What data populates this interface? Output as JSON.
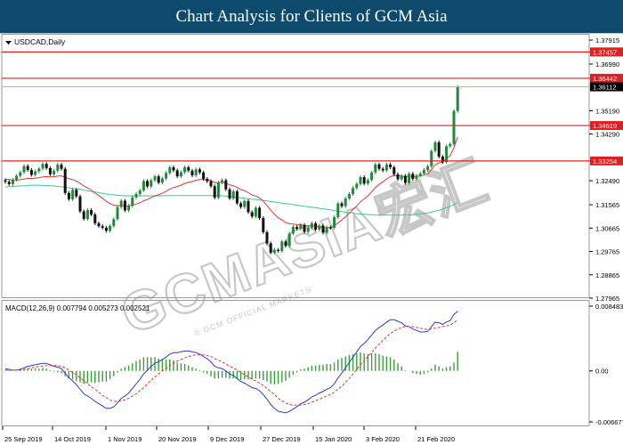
{
  "banner": {
    "title": "Chart Analysis for Clients of GCM Asia"
  },
  "instrument": {
    "label": "USDCAD,Daily"
  },
  "watermark": {
    "text": "GCMASIA宏汇",
    "subtext": "© GCM OFFICIAL MARKETS"
  },
  "colors": {
    "banner": "#0e4a6b",
    "bull": "#1f8a3a",
    "bear": "#111111",
    "ma_fast": "#e8332e",
    "ma_slow": "#3ec98d",
    "level_line": "#e02020",
    "level_tag": "#e02020",
    "price_tag": "#000000",
    "macd_line": "#2b3bd1",
    "macd_signal": "#e8332e",
    "macd_hist": "#3a9e3a"
  },
  "price_axis": {
    "ticks": [
      "1.37915",
      "1.36990",
      "1.35190",
      "1.34290",
      "1.32490",
      "1.31565",
      "1.30665",
      "1.29765",
      "1.28865",
      "1.27965"
    ]
  },
  "macd_axis": {
    "ticks": [
      "0.008483",
      "0.00",
      "-0.006677"
    ]
  },
  "macd": {
    "label": "MACD(12,26,9) 0.007794 0.005273 0.002521"
  },
  "time_axis": {
    "labels": [
      "25 Sep 2019",
      "14 Oct 2019",
      "1 Nov 2019",
      "20 Nov 2019",
      "9 Dec 2019",
      "27 Dec 2019",
      "15 Jan 2020",
      "3 Feb 2020",
      "21 Feb 2020"
    ]
  },
  "chart_data": {
    "type": "candlestick",
    "symbol": "USDCAD",
    "timeframe": "Daily",
    "ylim": [
      1.27965,
      1.37915
    ],
    "levels": [
      {
        "value": 1.37457,
        "label": "1.37457"
      },
      {
        "value": 1.36442,
        "label": "1.36442"
      },
      {
        "value": 1.34619,
        "label": "1.34619"
      },
      {
        "value": 1.33254,
        "label": "1.33254"
      }
    ],
    "current_price": {
      "value": 1.36112,
      "label": "1.36112"
    },
    "close": [
      1.3245,
      1.3236,
      1.3253,
      1.3268,
      1.3282,
      1.3306,
      1.3291,
      1.3272,
      1.3285,
      1.3296,
      1.3314,
      1.3298,
      1.3274,
      1.3288,
      1.3311,
      1.3295,
      1.3202,
      1.3178,
      1.3214,
      1.3189,
      1.3131,
      1.3102,
      1.3136,
      1.3119,
      1.3085,
      1.3074,
      1.3068,
      1.3056,
      1.3075,
      1.3101,
      1.3148,
      1.3172,
      1.3135,
      1.3153,
      1.3185,
      1.3198,
      1.3212,
      1.3248,
      1.3227,
      1.3251,
      1.3266,
      1.3242,
      1.3258,
      1.3279,
      1.3301,
      1.3289,
      1.3266,
      1.3282,
      1.3301,
      1.3288,
      1.327,
      1.3293,
      1.3281,
      1.3256,
      1.3247,
      1.3228,
      1.3184,
      1.3242,
      1.3251,
      1.3216,
      1.3181,
      1.3208,
      1.3162,
      1.3148,
      1.3171,
      1.3128,
      1.3111,
      1.3145,
      1.3105,
      1.3051,
      1.3008,
      1.2972,
      1.2983,
      1.2978,
      1.3015,
      1.2998,
      1.3046,
      1.3071,
      1.3064,
      1.3079,
      1.3052,
      1.3068,
      1.3085,
      1.3061,
      1.3076,
      1.3049,
      1.3069,
      1.3068,
      1.3109,
      1.3162,
      1.3151,
      1.3181,
      1.3198,
      1.3221,
      1.3237,
      1.3263,
      1.3238,
      1.3252,
      1.3281,
      1.3312,
      1.3295,
      1.3289,
      1.3312,
      1.3301,
      1.3274,
      1.3255,
      1.3268,
      1.3241,
      1.3276,
      1.3256,
      1.3269,
      1.3277,
      1.3291,
      1.3305,
      1.3364,
      1.3397,
      1.3342,
      1.3321,
      1.3382,
      1.3391,
      1.3518,
      1.3611
    ],
    "ma_fast": [
      1.3256,
      1.3254,
      1.3252,
      1.3252,
      1.3253,
      1.3256,
      1.3258,
      1.3258,
      1.3259,
      1.3261,
      1.3264,
      1.3265,
      1.3264,
      1.3265,
      1.3267,
      1.3268,
      1.3263,
      1.3257,
      1.3254,
      1.3248,
      1.3239,
      1.3229,
      1.3222,
      1.3213,
      1.3202,
      1.3192,
      1.3181,
      1.317,
      1.3161,
      1.3155,
      1.3153,
      1.3154,
      1.3152,
      1.3152,
      1.3155,
      1.3159,
      1.3164,
      1.3172,
      1.3177,
      1.3184,
      1.3191,
      1.3195,
      1.3201,
      1.3208,
      1.3217,
      1.3223,
      1.3227,
      1.3232,
      1.3239,
      1.3243,
      1.3246,
      1.3251,
      1.3254,
      1.3254,
      1.3253,
      1.325,
      1.3242,
      1.3242,
      1.3243,
      1.324,
      1.3233,
      1.323,
      1.3223,
      1.3215,
      1.3211,
      1.3203,
      1.3194,
      1.319,
      1.3183,
      1.317,
      1.3154,
      1.3135,
      1.312,
      1.3106,
      1.3098,
      1.3088,
      1.3083,
      1.3082,
      1.308,
      1.308,
      1.3076,
      1.3075,
      1.3076,
      1.3073,
      1.3073,
      1.3069,
      1.3069,
      1.3069,
      1.3074,
      1.3087,
      1.3097,
      1.311,
      1.3123,
      1.3138,
      1.3152,
      1.3168,
      1.3179,
      1.3191,
      1.3206,
      1.3223,
      1.3235,
      1.3245,
      1.3256,
      1.3265,
      1.3269,
      1.3268,
      1.3268,
      1.3265,
      1.3267,
      1.3266,
      1.3266,
      1.3268,
      1.3271,
      1.3276,
      1.3292,
      1.3311,
      1.3318,
      1.332,
      1.3334,
      1.3346,
      1.3377,
      1.3418
    ],
    "ma_slow": [
      1.3225,
      1.3226,
      1.3227,
      1.3228,
      1.3229,
      1.323,
      1.3231,
      1.3232,
      1.3232,
      1.3232,
      1.3231,
      1.3231,
      1.323,
      1.3229,
      1.3227,
      1.3226,
      1.3224,
      1.3222,
      1.322,
      1.3218,
      1.3216,
      1.3213,
      1.3211,
      1.3208,
      1.3206,
      1.3203,
      1.3201,
      1.3198,
      1.3196,
      1.3195,
      1.3193,
      1.3192,
      1.3191,
      1.3191,
      1.3191,
      1.3191,
      1.3191,
      1.3191,
      1.3191,
      1.3191,
      1.3191,
      1.3191,
      1.3191,
      1.3192,
      1.3192,
      1.3192,
      1.3192,
      1.3192,
      1.3192,
      1.3192,
      1.3192,
      1.3192,
      1.3192,
      1.3192,
      1.3192,
      1.3192,
      1.3192,
      1.3192,
      1.3191,
      1.319,
      1.3189,
      1.3187,
      1.3185,
      1.3183,
      1.3182,
      1.318,
      1.3178,
      1.3177,
      1.3175,
      1.3173,
      1.3171,
      1.3169,
      1.3167,
      1.3165,
      1.3163,
      1.3161,
      1.3159,
      1.3157,
      1.3155,
      1.3153,
      1.3151,
      1.3149,
      1.3147,
      1.3145,
      1.3143,
      1.3141,
      1.3139,
      1.3137,
      1.3134,
      1.3132,
      1.313,
      1.3128,
      1.3126,
      1.3124,
      1.3122,
      1.3121,
      1.312,
      1.3119,
      1.3118,
      1.3118,
      1.3117,
      1.3117,
      1.3117,
      1.3117,
      1.3117,
      1.3117,
      1.3117,
      1.3117,
      1.3117,
      1.3118,
      1.3119,
      1.3121,
      1.3123,
      1.3125,
      1.3128,
      1.3132,
      1.3136,
      1.314,
      1.3145,
      1.3151,
      1.3157,
      1.3165
    ],
    "macd_series": {
      "macd": [
        0.0003,
        0.0002,
        0.0001,
        0.0001,
        0.0002,
        0.0004,
        0.0006,
        0.0007,
        0.0008,
        0.0009,
        0.001,
        0.001,
        0.0008,
        0.0006,
        0.0005,
        0.0003,
        -0.0003,
        -0.0009,
        -0.0013,
        -0.0018,
        -0.0024,
        -0.003,
        -0.0033,
        -0.0036,
        -0.004,
        -0.0043,
        -0.0046,
        -0.0049,
        -0.0049,
        -0.0047,
        -0.0042,
        -0.0036,
        -0.0033,
        -0.0029,
        -0.0023,
        -0.0017,
        -0.0011,
        -0.0004,
        0.0001,
        0.0006,
        0.001,
        0.0012,
        0.0015,
        0.0018,
        0.0022,
        0.0024,
        0.0024,
        0.0025,
        0.0026,
        0.0026,
        0.0025,
        0.0024,
        0.0022,
        0.0019,
        0.0016,
        0.0012,
        0.0006,
        0.0004,
        0.0003,
        0.0,
        -0.0004,
        -0.0006,
        -0.001,
        -0.0014,
        -0.0016,
        -0.0019,
        -0.0022,
        -0.0023,
        -0.0026,
        -0.0031,
        -0.0037,
        -0.0044,
        -0.0049,
        -0.0053,
        -0.0054,
        -0.0055,
        -0.0053,
        -0.005,
        -0.0047,
        -0.0043,
        -0.0041,
        -0.0038,
        -0.0034,
        -0.0032,
        -0.0029,
        -0.0027,
        -0.0024,
        -0.0022,
        -0.0017,
        -0.0009,
        -0.0003,
        0.0004,
        0.0011,
        0.0018,
        0.0025,
        0.0032,
        0.0036,
        0.0041,
        0.0047,
        0.0053,
        0.0057,
        0.006,
        0.0064,
        0.0067,
        0.0067,
        0.0065,
        0.0063,
        0.0059,
        0.0058,
        0.0055,
        0.0053,
        0.0051,
        0.0051,
        0.0052,
        0.0058,
        0.0064,
        0.0063,
        0.0061,
        0.0064,
        0.0066,
        0.0074,
        0.0078
      ],
      "signal": [
        0.0001,
        0.0001,
        0.0001,
        0.0001,
        0.0001,
        0.0002,
        0.0003,
        0.0004,
        0.0005,
        0.0006,
        0.0006,
        0.0007,
        0.0007,
        0.0007,
        0.0007,
        0.0006,
        0.0004,
        0.0001,
        -0.0002,
        -0.0005,
        -0.0009,
        -0.0013,
        -0.0017,
        -0.0021,
        -0.0024,
        -0.0028,
        -0.0032,
        -0.0035,
        -0.0038,
        -0.004,
        -0.004,
        -0.0039,
        -0.0038,
        -0.0036,
        -0.0033,
        -0.003,
        -0.0026,
        -0.0022,
        -0.0017,
        -0.0012,
        -0.0008,
        -0.0004,
        -0.0,
        0.0003,
        0.0007,
        0.001,
        0.0013,
        0.0015,
        0.0017,
        0.0019,
        0.002,
        0.0021,
        0.0021,
        0.0021,
        0.002,
        0.0019,
        0.0016,
        0.0014,
        0.0012,
        0.0009,
        0.0006,
        0.0004,
        0.0001,
        -0.0002,
        -0.0005,
        -0.0008,
        -0.0011,
        -0.0013,
        -0.0016,
        -0.0019,
        -0.0023,
        -0.0027,
        -0.0031,
        -0.0036,
        -0.0039,
        -0.0042,
        -0.0044,
        -0.0045,
        -0.0045,
        -0.0045,
        -0.0044,
        -0.0043,
        -0.0041,
        -0.0039,
        -0.0037,
        -0.0035,
        -0.0033,
        -0.0031,
        -0.0028,
        -0.0024,
        -0.002,
        -0.0015,
        -0.001,
        -0.0004,
        0.0002,
        0.0008,
        0.0013,
        0.0019,
        0.0024,
        0.003,
        0.0035,
        0.004,
        0.0045,
        0.0049,
        0.0052,
        0.0055,
        0.0057,
        0.0058,
        0.0058,
        0.0058,
        0.0057,
        0.0056,
        0.0055,
        0.0054,
        0.0055,
        0.0056,
        0.0057,
        0.0058,
        0.0059,
        0.006,
        0.0063,
        0.0067
      ],
      "histogram": [
        0.0001,
        0.0001,
        0.0,
        0.0,
        0.0001,
        0.0002,
        0.0003,
        0.0003,
        0.0003,
        0.0003,
        0.0004,
        0.0003,
        0.0001,
        -0.0001,
        -0.0002,
        -0.0003,
        -0.0007,
        -0.001,
        -0.0011,
        -0.0013,
        -0.0015,
        -0.0017,
        -0.0016,
        -0.0015,
        -0.0016,
        -0.0015,
        -0.0014,
        -0.0014,
        -0.0011,
        -0.0007,
        -0.0002,
        0.0003,
        0.0005,
        0.0007,
        0.001,
        0.0013,
        0.0015,
        0.0018,
        0.0018,
        0.0018,
        0.0018,
        0.0016,
        0.0015,
        0.0015,
        0.0015,
        0.0014,
        0.0011,
        0.001,
        0.0009,
        0.0007,
        0.0005,
        0.0003,
        0.0001,
        -0.0002,
        -0.0004,
        -0.0007,
        -0.001,
        -0.001,
        -0.0009,
        -0.0009,
        -0.001,
        -0.001,
        -0.0011,
        -0.0012,
        -0.0011,
        -0.0011,
        -0.0011,
        -0.001,
        -0.001,
        -0.0012,
        -0.0014,
        -0.0017,
        -0.0018,
        -0.0017,
        -0.0015,
        -0.0013,
        -0.0009,
        -0.0005,
        -0.0002,
        0.0002,
        0.0003,
        0.0005,
        0.0007,
        0.0007,
        0.0008,
        0.0008,
        0.0009,
        0.0009,
        0.0011,
        0.0015,
        0.0017,
        0.0019,
        0.0021,
        0.0022,
        0.0023,
        0.0024,
        0.0023,
        0.0022,
        0.0023,
        0.0023,
        0.0022,
        0.002,
        0.0019,
        0.0018,
        0.0015,
        0.001,
        0.0006,
        0.0001,
        -0.0,
        -0.0003,
        -0.0004,
        -0.0005,
        -0.0004,
        -0.0002,
        0.0003,
        0.0008,
        0.0006,
        0.0003,
        0.0005,
        0.0006,
        0.0011,
        0.0025
      ]
    }
  }
}
